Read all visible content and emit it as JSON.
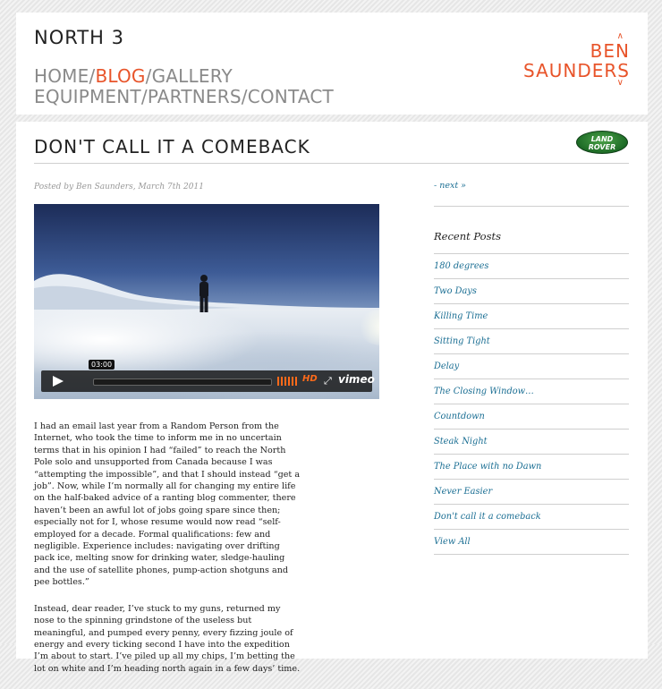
{
  "header": {
    "site_title": "NORTH 3",
    "nav_line1": [
      {
        "label": "HOME",
        "active": false
      },
      {
        "label": "BLOG",
        "active": true
      },
      {
        "label": "GALLERY",
        "active": false
      }
    ],
    "nav_line2": [
      {
        "label": "EQUIPMENT",
        "active": false
      },
      {
        "label": "PARTNERS",
        "active": false
      },
      {
        "label": "CONTACT",
        "active": false
      }
    ],
    "separator": "/",
    "brand_line1": "BEN",
    "brand_line2": "SAUNDERS",
    "brand_color": "#e8542a"
  },
  "post": {
    "title": "DON'T CALL IT A COMEBACK",
    "meta": "Posted by Ben Saunders, March 7th 2011",
    "sponsor_line1": "LAND",
    "sponsor_line2": "ROVER",
    "video": {
      "time": "03:00",
      "hd_label": "HD",
      "brand": "vimeo",
      "progress_fraction": 0
    },
    "paragraphs": [
      "I had an email last year from a Random Person from the Internet, who took the time to inform me in no uncertain terms that in his opinion I had “failed” to reach the North Pole solo and unsupported from Canada because I was “attempting the impossible”, and that I should instead “get a job”. Now, while I’m normally all for changing my entire life on the half-baked advice of a ranting blog commenter, there haven’t been an awful lot of jobs going spare since then; especially not for I, whose resume would now read “self-employed for a decade. Formal qualifications: few and negligible. Experience includes: navigating over drifting pack ice, melting snow for drinking water, sledge-hauling and the use of satellite phones, pump-action shotguns and pee bottles.”",
      "Instead, dear reader, I’ve stuck to my guns, returned my nose to the spinning grindstone of the useless but meaningful, and pumped every penny, every fizzing joule of energy and every ticking second I have into the expedition I’m about to start. I’ve piled up all my chips, I’m betting the lot on white and I’m heading north again in a few days’ time."
    ]
  },
  "sidebar": {
    "next_label": "- next »",
    "recent_heading": "Recent Posts",
    "recent_posts": [
      "180 degrees",
      "Two Days",
      "Killing Time",
      "Sitting Tight",
      "Delay",
      "The Closing Window…",
      "Countdown",
      "Steak Night",
      "The Place with no Dawn",
      "Never Easier",
      "Don't call it a comeback",
      "View All"
    ],
    "link_color": "#1a6e93"
  }
}
